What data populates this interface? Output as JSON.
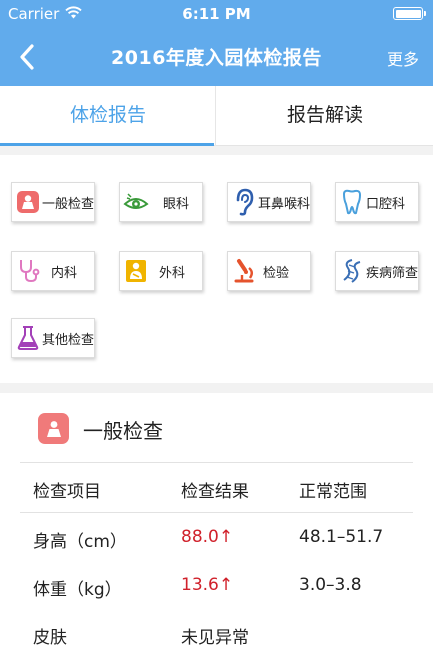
{
  "status": {
    "carrier": "Carrier",
    "time": "6:11 PM"
  },
  "nav": {
    "title": "2016年度入园体检报告",
    "more": "更多"
  },
  "tabs": [
    {
      "label": "体检报告",
      "active": true
    },
    {
      "label": "报告解读",
      "active": false
    }
  ],
  "categories": [
    {
      "label": "一般检查",
      "icon": "scale-icon"
    },
    {
      "label": "眼科",
      "icon": "eye-icon"
    },
    {
      "label": "耳鼻喉科",
      "icon": "ear-icon"
    },
    {
      "label": "口腔科",
      "icon": "tooth-icon"
    },
    {
      "label": "内科",
      "icon": "stethoscope-icon"
    },
    {
      "label": "外科",
      "icon": "bandage-person-icon"
    },
    {
      "label": "检验",
      "icon": "microscope-icon"
    },
    {
      "label": "疾病筛查",
      "icon": "dna-icon"
    },
    {
      "label": "其他检查",
      "icon": "flask-icon"
    }
  ],
  "section": {
    "title": "一般检查",
    "icon": "scale-icon",
    "headers": [
      "检查项目",
      "检查结果",
      "正常范围"
    ],
    "rows": [
      {
        "item": "身高（cm）",
        "result": "88.0↑",
        "range": "48.1–51.7",
        "abnormal": true
      },
      {
        "item": "体重（kg）",
        "result": "13.6↑",
        "range": "3.0–3.8",
        "abnormal": true
      },
      {
        "item": "皮肤",
        "result": "未见异常",
        "range": "",
        "abnormal": false
      }
    ]
  },
  "colors": {
    "header_bg": "#61abec",
    "accent": "#4da3e8",
    "abnormal": "#d0212b"
  }
}
